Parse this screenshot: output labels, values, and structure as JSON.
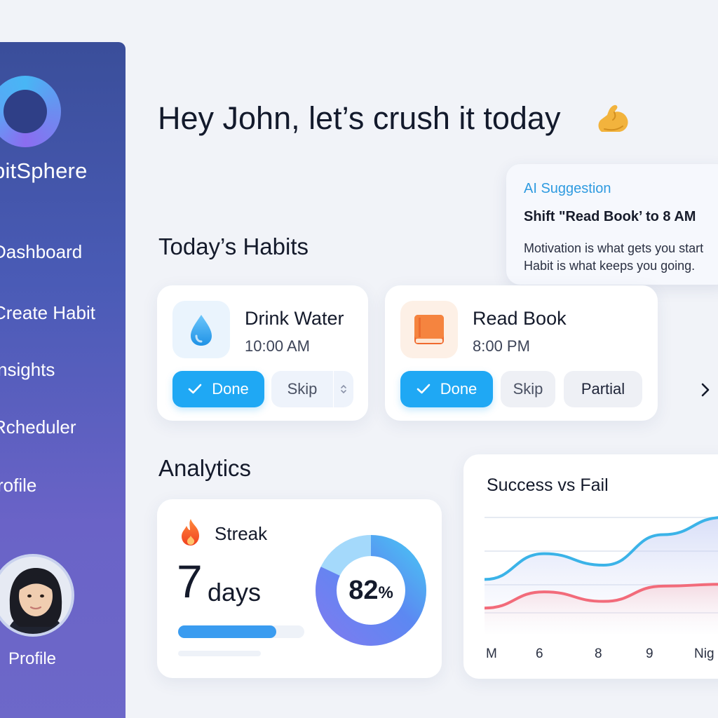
{
  "sidebar": {
    "brand": "bitSphere",
    "items": [
      {
        "label": "Dashboard"
      },
      {
        "label": "Create Habit"
      },
      {
        "label": "nsights"
      },
      {
        "label": "Rcheduler"
      },
      {
        "label": "rofile"
      }
    ],
    "profile_label": "Profile"
  },
  "header": {
    "greeting": "Hey John, let’s crush it today",
    "emoji": "flexed-biceps-icon"
  },
  "suggestion": {
    "tag": "AI Suggestion",
    "title": "Shift \"Read Book’ to 8 AM",
    "quote_line1": "Motivation is what gets you start",
    "quote_line2": "Habit is what keeps you going."
  },
  "habits": {
    "section_title": "Today’s Habits",
    "items": [
      {
        "name": "Drink Water",
        "time": "10:00 AM",
        "icon": "water-drop-icon",
        "icon_bg": "#eaf4fd"
      },
      {
        "name": "Read Book",
        "time": "8:00 PM",
        "icon": "book-icon",
        "icon_bg": "#fdf0e6"
      }
    ],
    "done_label": "Done",
    "skip_label": "Skip",
    "partial_label": "Partial"
  },
  "analytics": {
    "section_title": "Analytics",
    "streak": {
      "label": "Streak",
      "value": "7",
      "unit": "days",
      "progress": 0.78
    },
    "completion": {
      "value": "82",
      "unit": "%",
      "fraction": 0.82
    }
  },
  "colors": {
    "accent": "#1fa8f4",
    "success_line": "#3bb3e8",
    "fail_line": "#f26b7a",
    "sidebar_top": "#3a4e9a",
    "sidebar_bottom": "#6d68c9"
  },
  "chart_data": {
    "type": "line",
    "title": "Success vs Fail",
    "x": [
      "M",
      "6",
      "8",
      "9",
      "Nig"
    ],
    "grid": true,
    "series": [
      {
        "values": [
          0.35,
          0.62,
          0.5,
          0.82,
          1.0
        ]
      },
      {
        "values": [
          0.05,
          0.22,
          0.12,
          0.28,
          0.3
        ]
      }
    ],
    "ylim": [
      0,
      1
    ]
  }
}
